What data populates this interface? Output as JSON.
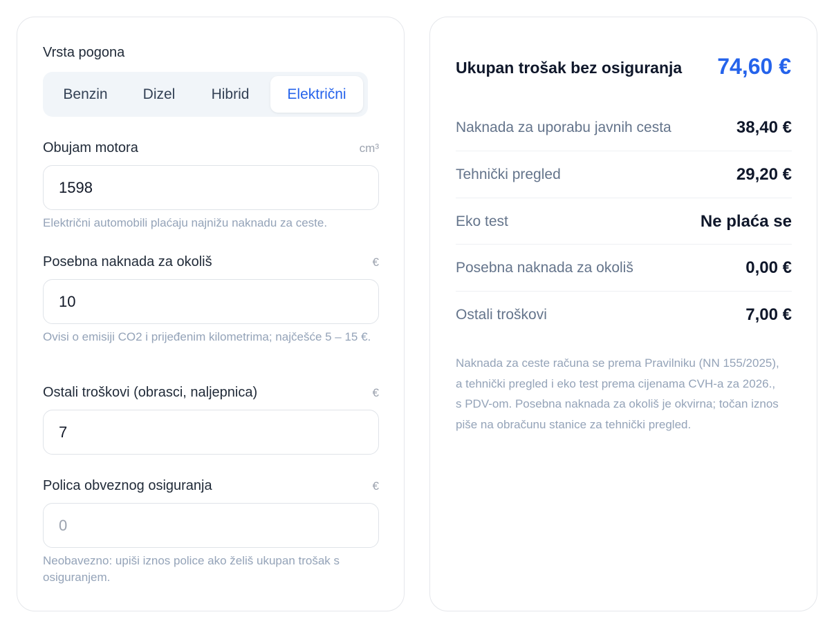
{
  "form": {
    "drive_type": {
      "label": "Vrsta pogona",
      "options": [
        "Benzin",
        "Dizel",
        "Hibrid",
        "Električni"
      ],
      "selected": "Električni"
    },
    "engine": {
      "label": "Obujam motora",
      "unit": "cm³",
      "value": "1598",
      "hint": "Električni automobili plaćaju najnižu naknadu za ceste."
    },
    "environment_fee": {
      "label": "Posebna naknada za okoliš",
      "unit": "€",
      "value": "10",
      "hint": "Ovisi o emisiji CO2 i prijeđenim kilometrima; najčešće 5 – 15 €."
    },
    "other_costs": {
      "label": "Ostali troškovi (obrasci, naljepnica)",
      "unit": "€",
      "value": "7"
    },
    "insurance": {
      "label": "Polica obveznog osiguranja",
      "unit": "€",
      "placeholder": "0",
      "value": "",
      "hint": "Neobavezno: upiši iznos police ako želiš ukupan trošak s osiguranjem."
    }
  },
  "summary": {
    "total_label": "Ukupan trošak bez osiguranja",
    "total_value": "74,60 €",
    "rows": [
      {
        "label": "Naknada za uporabu javnih cesta",
        "value": "38,40 €"
      },
      {
        "label": "Tehnički pregled",
        "value": "29,20 €"
      },
      {
        "label": "Eko test",
        "value": "Ne plaća se"
      },
      {
        "label": "Posebna naknada za okoliš",
        "value": "0,00 €"
      },
      {
        "label": "Ostali troškovi",
        "value": "7,00 €"
      }
    ],
    "note": "Naknada za ceste računa se prema Pravilniku (NN 155/2025), a tehnički pregled i eko test prema cijenama CVH-a za 2026., s PDV-om. Posebna naknada za okoliš je okvirna; točan iznos piše na obračunu stanice za tehnički pregled."
  },
  "colors": {
    "accent": "#2563eb",
    "muted_text": "#94a3b8",
    "segmented_bg": "#f1f5f9"
  }
}
